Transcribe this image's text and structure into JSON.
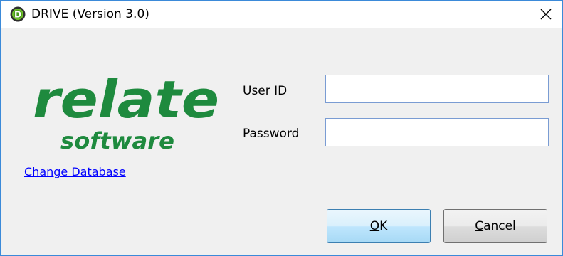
{
  "window": {
    "title": "DRIVE (Version 3.0)",
    "app_icon": "drive-d-icon",
    "close_icon": "close-icon",
    "close_glyph": "✕"
  },
  "logo": {
    "word_primary": "relate",
    "word_secondary": "software",
    "color": "#1e8a3e"
  },
  "link": {
    "change_database": "Change Database"
  },
  "form": {
    "user_id_label": "User ID",
    "user_id_value": "",
    "password_label": "Password",
    "password_value": ""
  },
  "buttons": {
    "ok_accel": "O",
    "ok_rest": "K",
    "cancel_accel": "C",
    "cancel_rest": "ancel"
  },
  "colors": {
    "window_border": "#3b8ad9",
    "link": "#0000ff",
    "field_border": "#7a9cd3",
    "button_border": "#3c7fb1"
  }
}
